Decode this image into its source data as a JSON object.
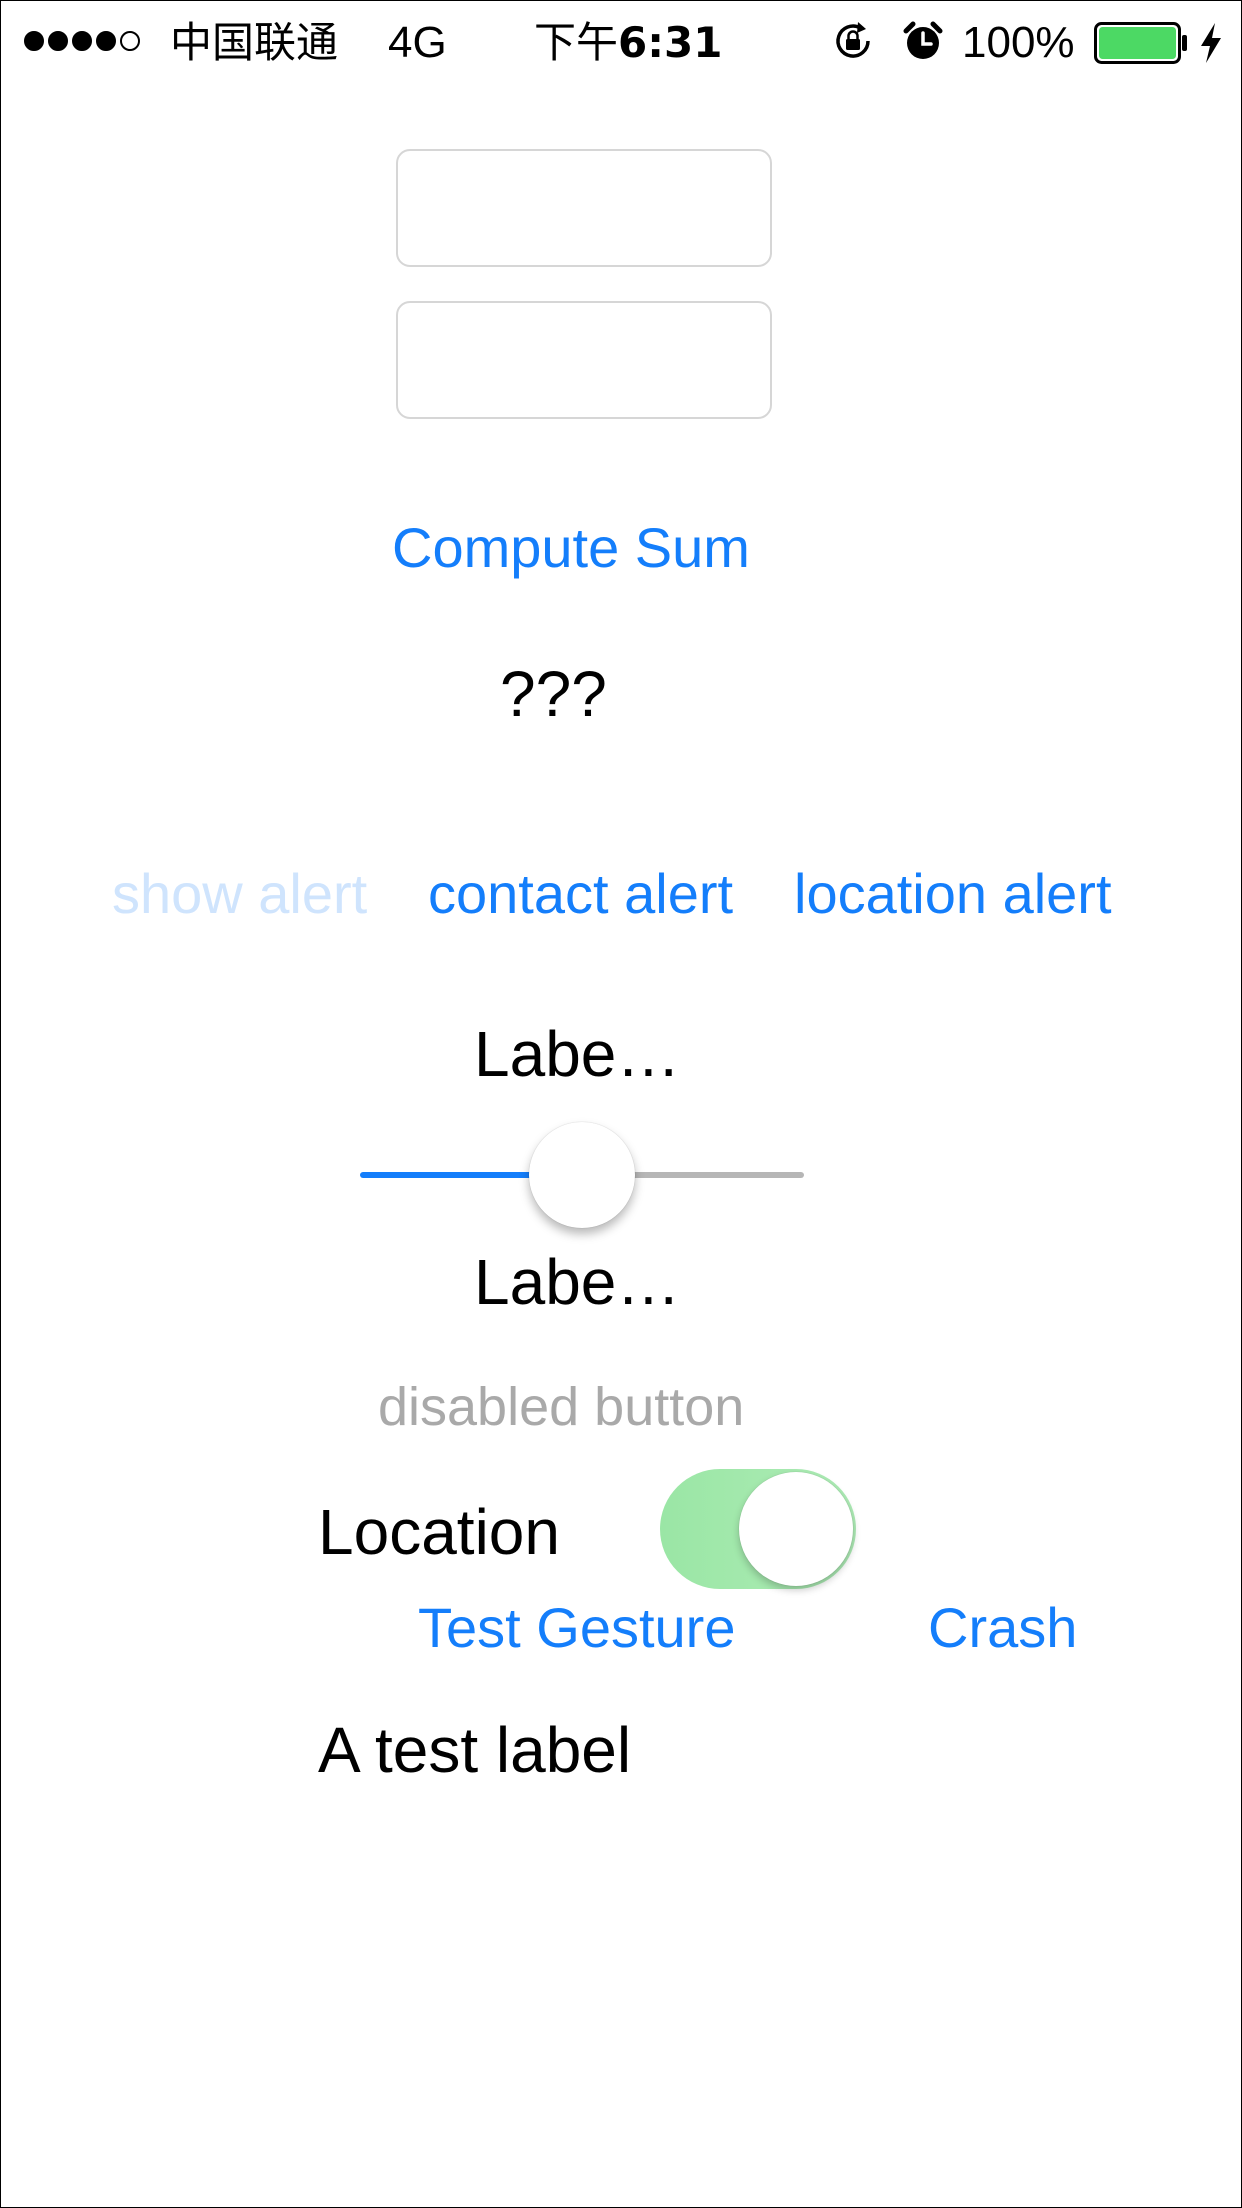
{
  "status_bar": {
    "signal_dots": [
      true,
      true,
      true,
      true,
      false
    ],
    "carrier": "中国联通",
    "network": "4G",
    "time_prefix": "下午",
    "time": "6:31",
    "battery_percent": "100%",
    "battery_level": 1.0,
    "battery_color": "#4cd964",
    "icons": [
      "signal-dots-icon",
      "orientation-lock-icon",
      "alarm-clock-icon",
      "battery-icon",
      "charging-bolt-icon"
    ]
  },
  "form": {
    "field1": {
      "value": "",
      "placeholder": ""
    },
    "field2": {
      "value": "",
      "placeholder": ""
    },
    "compute_label": "Compute Sum",
    "result_text": "???"
  },
  "alerts": {
    "show_label": "show alert",
    "contact_label": "contact alert",
    "location_label": "location alert"
  },
  "slider": {
    "label_top": "Labe…",
    "label_bottom": "Labe…",
    "value": 0.5,
    "min_track_color": "#147efb",
    "max_track_color": "#b6b6b6"
  },
  "disabled_button_label": "disabled button",
  "location": {
    "label": "Location",
    "switch_on": true,
    "switch_color": "#a6e9b0"
  },
  "gestures": {
    "test_gesture_label": "Test Gesture",
    "crash_label": "Crash"
  },
  "test_label": "A test label",
  "colors": {
    "accent": "#147efb",
    "disabled": "#a9a9a9",
    "faded_accent": "#cfe4fd"
  }
}
